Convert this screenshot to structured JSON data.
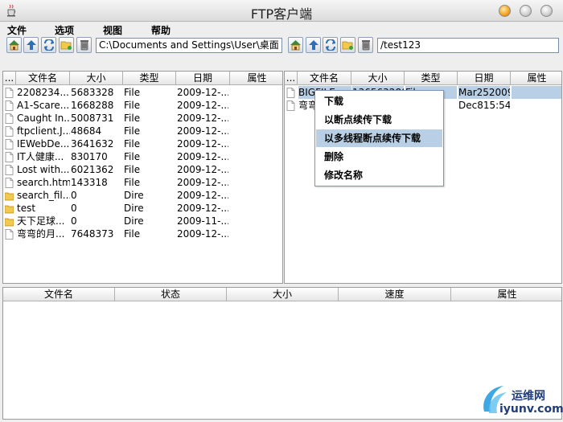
{
  "window": {
    "title": "FTP客户端"
  },
  "menu": [
    "文件",
    "选项",
    "视图",
    "帮助"
  ],
  "local": {
    "path": "C:\\Documents and Settings\\User\\桌面",
    "columns": [
      "...",
      "文件名",
      "大小",
      "类型",
      "日期",
      "属性"
    ],
    "rows": [
      {
        "name": "2208234....",
        "size": "5683328",
        "type": "File",
        "date": "2009-12-...",
        "icon": "file"
      },
      {
        "name": "A1-Scare....",
        "size": "1668288",
        "type": "File",
        "date": "2009-12-...",
        "icon": "file"
      },
      {
        "name": "Caught In...",
        "size": "5008731",
        "type": "File",
        "date": "2009-12-...",
        "icon": "file"
      },
      {
        "name": "ftpclient.J...",
        "size": "48684",
        "type": "File",
        "date": "2009-12-...",
        "icon": "file"
      },
      {
        "name": "IEWebDe...",
        "size": "3641632",
        "type": "File",
        "date": "2009-12-...",
        "icon": "file"
      },
      {
        "name": "IT人健康...",
        "size": "830170",
        "type": "File",
        "date": "2009-12-...",
        "icon": "file"
      },
      {
        "name": "Lost with...",
        "size": "6021362",
        "type": "File",
        "date": "2009-12-...",
        "icon": "file"
      },
      {
        "name": "search.htm",
        "size": "143318",
        "type": "File",
        "date": "2009-12-...",
        "icon": "file"
      },
      {
        "name": "search_fil...",
        "size": "0",
        "type": "Dire",
        "date": "2009-12-...",
        "icon": "folder"
      },
      {
        "name": "test",
        "size": "0",
        "type": "Dire",
        "date": "2009-12-...",
        "icon": "folder"
      },
      {
        "name": "天下足球...",
        "size": "0",
        "type": "Dire",
        "date": "2009-11-...",
        "icon": "folder"
      },
      {
        "name": "弯弯的月...",
        "size": "7648373",
        "type": "File",
        "date": "2009-12-...",
        "icon": "file"
      }
    ]
  },
  "remote": {
    "path": "/test123",
    "columns": [
      "...",
      "文件名",
      "大小",
      "类型",
      "日期",
      "属性"
    ],
    "rows": [
      {
        "name": "BIGFILE.rar",
        "size": "136563280",
        "type": "File",
        "date": "Mar252009",
        "selected": true
      },
      {
        "name": "弯弯",
        "size": "",
        "type": "",
        "date": "Dec815:54",
        "selected": false
      }
    ]
  },
  "context_menu": {
    "items": [
      "下载",
      "以断点续传下载",
      "以多线程断点续传下载",
      "删除",
      "修改名称"
    ],
    "highlighted": 2
  },
  "transfer": {
    "columns": [
      "文件名",
      "状态",
      "大小",
      "速度",
      "属性"
    ]
  },
  "watermark": {
    "line1": "运维网",
    "line2": "iyunv.com"
  },
  "colors": {
    "selection": "#b8cfe5",
    "folder": "#f2c94c",
    "toolbar_blue": "#2f6fb5"
  },
  "icons": {
    "toolbar": [
      "home-icon",
      "up-arrow-icon",
      "refresh-icon",
      "new-folder-icon",
      "delete-icon"
    ]
  }
}
